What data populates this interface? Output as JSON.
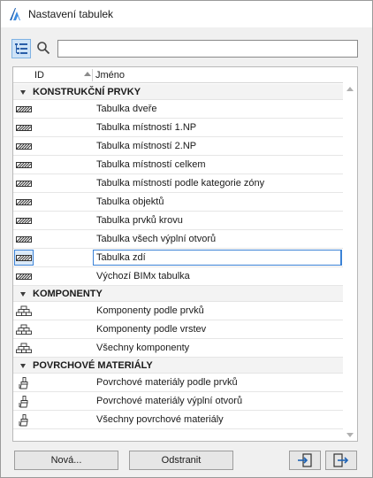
{
  "window": {
    "title": "Nastavení tabulek"
  },
  "search": {
    "value": "",
    "placeholder": ""
  },
  "columns": {
    "id": "ID",
    "name": "Jméno"
  },
  "groups": [
    {
      "label": "KONSTRUKČNÍ PRVKY",
      "icon": "hatched-wall-icon",
      "items": [
        "Tabulka dveře",
        "Tabulka místností 1.NP",
        "Tabulka místností 2.NP",
        "Tabulka místností celkem",
        "Tabulka místností podle kategorie zóny",
        "Tabulka objektů",
        "Tabulka prvků krovu",
        "Tabulka všech výplní otvorů",
        "Tabulka zdí",
        "Výchozí BIMx tabulka"
      ],
      "selected_index": 8
    },
    {
      "label": "KOMPONENTY",
      "icon": "brick-stack-icon",
      "items": [
        "Komponenty podle prvků",
        "Komponenty podle vrstev",
        "Všechny komponenty"
      ]
    },
    {
      "label": "POVRCHOVÉ MATERIÁLY",
      "icon": "paint-brush-icon",
      "items": [
        "Povrchové materiály podle prvků",
        "Povrchové materiály výplní otvorů",
        "Všechny povrchové materiály"
      ]
    }
  ],
  "buttons": {
    "new": "Nová...",
    "delete": "Odstranit"
  },
  "colors": {
    "selection": "#3b82d6",
    "accent_bg": "#cfe3f7"
  }
}
